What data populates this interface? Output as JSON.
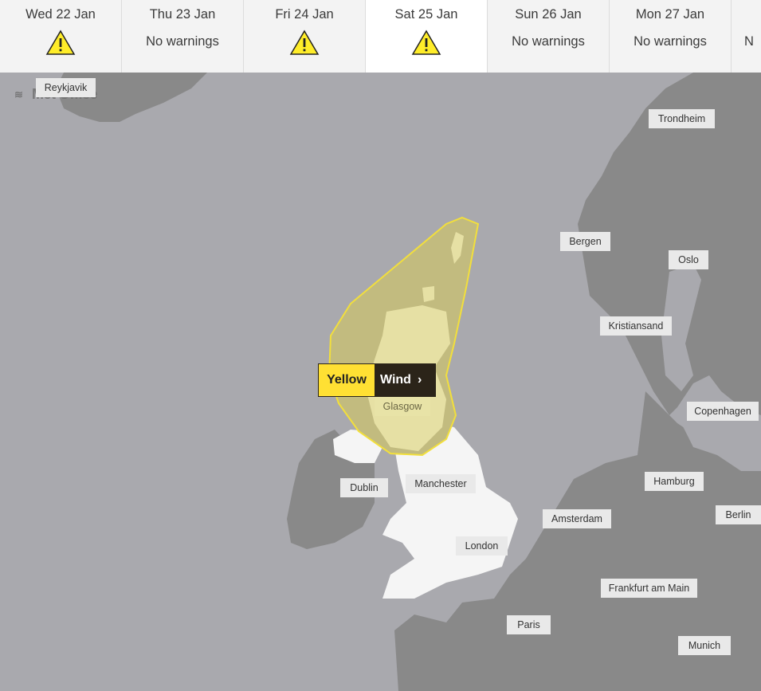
{
  "days": [
    {
      "date": "Wed 22 Jan",
      "status": "warning",
      "status_text": ""
    },
    {
      "date": "Thu 23 Jan",
      "status": "none",
      "status_text": "No warnings"
    },
    {
      "date": "Fri 24 Jan",
      "status": "warning",
      "status_text": ""
    },
    {
      "date": "Sat 25 Jan",
      "status": "warning",
      "status_text": "",
      "active": true
    },
    {
      "date": "Sun 26 Jan",
      "status": "none",
      "status_text": "No warnings"
    },
    {
      "date": "Mon 27 Jan",
      "status": "none",
      "status_text": "No warnings"
    },
    {
      "date": "",
      "status": "none",
      "status_text": "No warnings"
    }
  ],
  "map": {
    "logo": "Met Office",
    "cities": [
      "Reykjavik",
      "Trondheim",
      "Bergen",
      "Oslo",
      "Kristiansand",
      "Copenhagen",
      "Glasgow",
      "Dublin",
      "Manchester",
      "Hamburg",
      "Berlin",
      "Amsterdam",
      "London",
      "Frankfurt am Main",
      "Paris",
      "Munich"
    ],
    "warning": {
      "level": "Yellow",
      "type": "Wind",
      "chevron": "›"
    },
    "colors": {
      "sea": "#a9a9ae",
      "land_other": "#898989",
      "land_uk": "#f5f5f5",
      "warning_fill": "#e3dc8e",
      "warning_border": "#f2df3c",
      "warning_yellow": "#ffe033",
      "pill_dark": "#2b2419"
    }
  }
}
